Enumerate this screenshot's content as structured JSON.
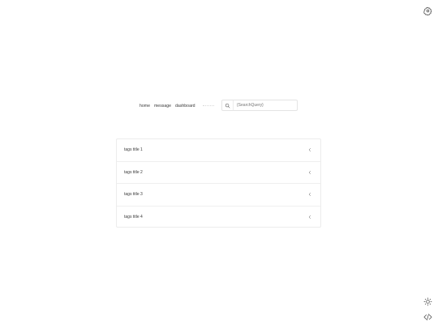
{
  "header": {
    "settings_icon": "gear-icon"
  },
  "nav": {
    "links": [
      {
        "label": "home"
      },
      {
        "label": "message"
      },
      {
        "label": "dashboard"
      }
    ]
  },
  "search": {
    "icon": "search-icon",
    "placeholder": "{SearchQuery}",
    "value": ""
  },
  "tags": {
    "items": [
      {
        "title": "tags title 1",
        "icon": "chevron-left-icon"
      },
      {
        "title": "tags title 2",
        "icon": "chevron-left-icon"
      },
      {
        "title": "tags title 3",
        "icon": "chevron-left-icon"
      },
      {
        "title": "tags title 4",
        "icon": "chevron-left-icon"
      }
    ]
  },
  "footer_controls": {
    "theme_icon": "sun-icon",
    "code_icon": "code-icon"
  }
}
